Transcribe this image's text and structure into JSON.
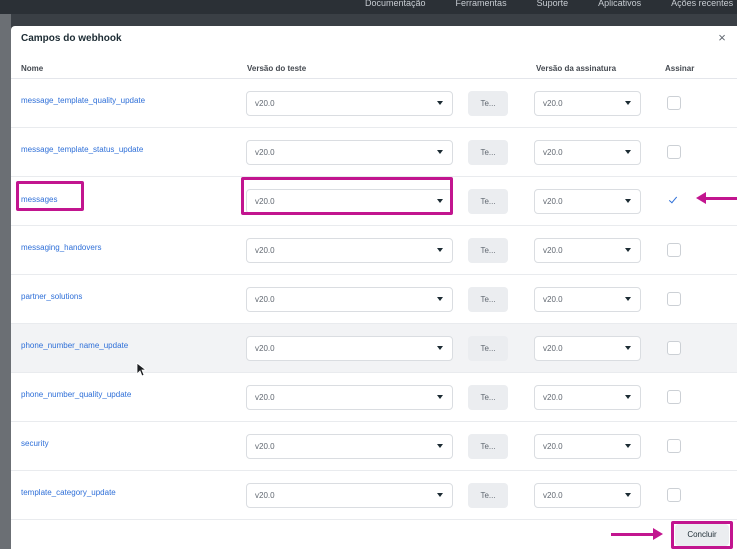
{
  "top_nav": [
    "Documentação",
    "Ferramentas",
    "Suporte",
    "Aplicativos",
    "Ações recentes"
  ],
  "modal": {
    "title": "Campos do webhook",
    "close_label": "×",
    "columns": {
      "name": "Nome",
      "test_version": "Versão do teste",
      "subscription_version": "Versão da assinatura",
      "subscribe": "Assinar"
    },
    "rows": [
      {
        "name": "message_template_quality_update",
        "test_version": "v20.0",
        "test_button": "Te...",
        "subscription_version": "v20.0",
        "subscribed": false
      },
      {
        "name": "message_template_status_update",
        "test_version": "v20.0",
        "test_button": "Te...",
        "subscription_version": "v20.0",
        "subscribed": false
      },
      {
        "name": "messages",
        "test_version": "v20.0",
        "test_button": "Te...",
        "subscription_version": "v20.0",
        "subscribed": true
      },
      {
        "name": "messaging_handovers",
        "test_version": "v20.0",
        "test_button": "Te...",
        "subscription_version": "v20.0",
        "subscribed": false
      },
      {
        "name": "partner_solutions",
        "test_version": "v20.0",
        "test_button": "Te...",
        "subscription_version": "v20.0",
        "subscribed": false
      },
      {
        "name": "phone_number_name_update",
        "test_version": "v20.0",
        "test_button": "Te...",
        "subscription_version": "v20.0",
        "subscribed": false
      },
      {
        "name": "phone_number_quality_update",
        "test_version": "v20.0",
        "test_button": "Te...",
        "subscription_version": "v20.0",
        "subscribed": false
      },
      {
        "name": "security",
        "test_version": "v20.0",
        "test_button": "Te...",
        "subscription_version": "v20.0",
        "subscribed": false
      },
      {
        "name": "template_category_update",
        "test_version": "v20.0",
        "test_button": "Te...",
        "subscription_version": "v20.0",
        "subscribed": false
      }
    ],
    "done_button": "Concluir"
  },
  "colors": {
    "highlight": "#c2158f",
    "link": "#2e6fd8"
  }
}
